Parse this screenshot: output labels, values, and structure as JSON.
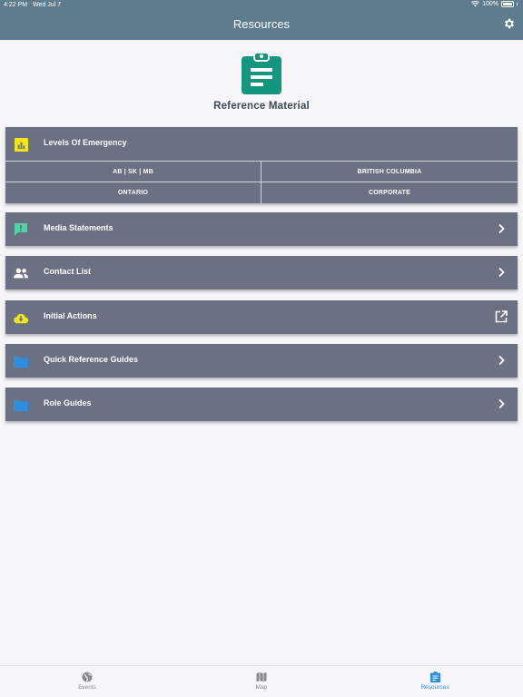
{
  "status_bar": {
    "time": "4:22 PM",
    "date": "Wed Jul 7",
    "battery": "100%"
  },
  "header": {
    "title": "Resources",
    "settings_icon": "gear-icon"
  },
  "hero": {
    "icon": "clipboard-icon",
    "title": "Reference Material",
    "icon_color": "#14967e"
  },
  "levels": {
    "label": "Levels Of Emergency",
    "icon": "bar-chart-icon",
    "regions": [
      "AB | SK | MB",
      "BRITISH COLUMBIA",
      "ONTARIO",
      "CORPORATE"
    ]
  },
  "menu": [
    {
      "label": "Media Statements",
      "icon": "message-alert-icon",
      "trailing": "chevron-right-icon"
    },
    {
      "label": "Contact List",
      "icon": "people-icon",
      "trailing": "chevron-right-icon"
    },
    {
      "label": "Initial Actions",
      "icon": "cloud-download-icon",
      "trailing": "external-link-icon"
    },
    {
      "label": "Quick Reference Guides",
      "icon": "folder-icon",
      "trailing": "chevron-right-icon"
    },
    {
      "label": "Role Guides",
      "icon": "folder-icon",
      "trailing": "chevron-right-icon"
    }
  ],
  "tabs": [
    {
      "label": "Events",
      "icon": "globe-icon"
    },
    {
      "label": "Map",
      "icon": "map-icon"
    },
    {
      "label": "Resources",
      "icon": "clipboard-icon",
      "active": true
    }
  ],
  "colors": {
    "header": "#5f7c8e",
    "card": "#6b7183",
    "accent": "#2f8ee0",
    "yellow": "#f2e51a",
    "green": "#4fd6a6",
    "folder": "#2f8ee0"
  }
}
